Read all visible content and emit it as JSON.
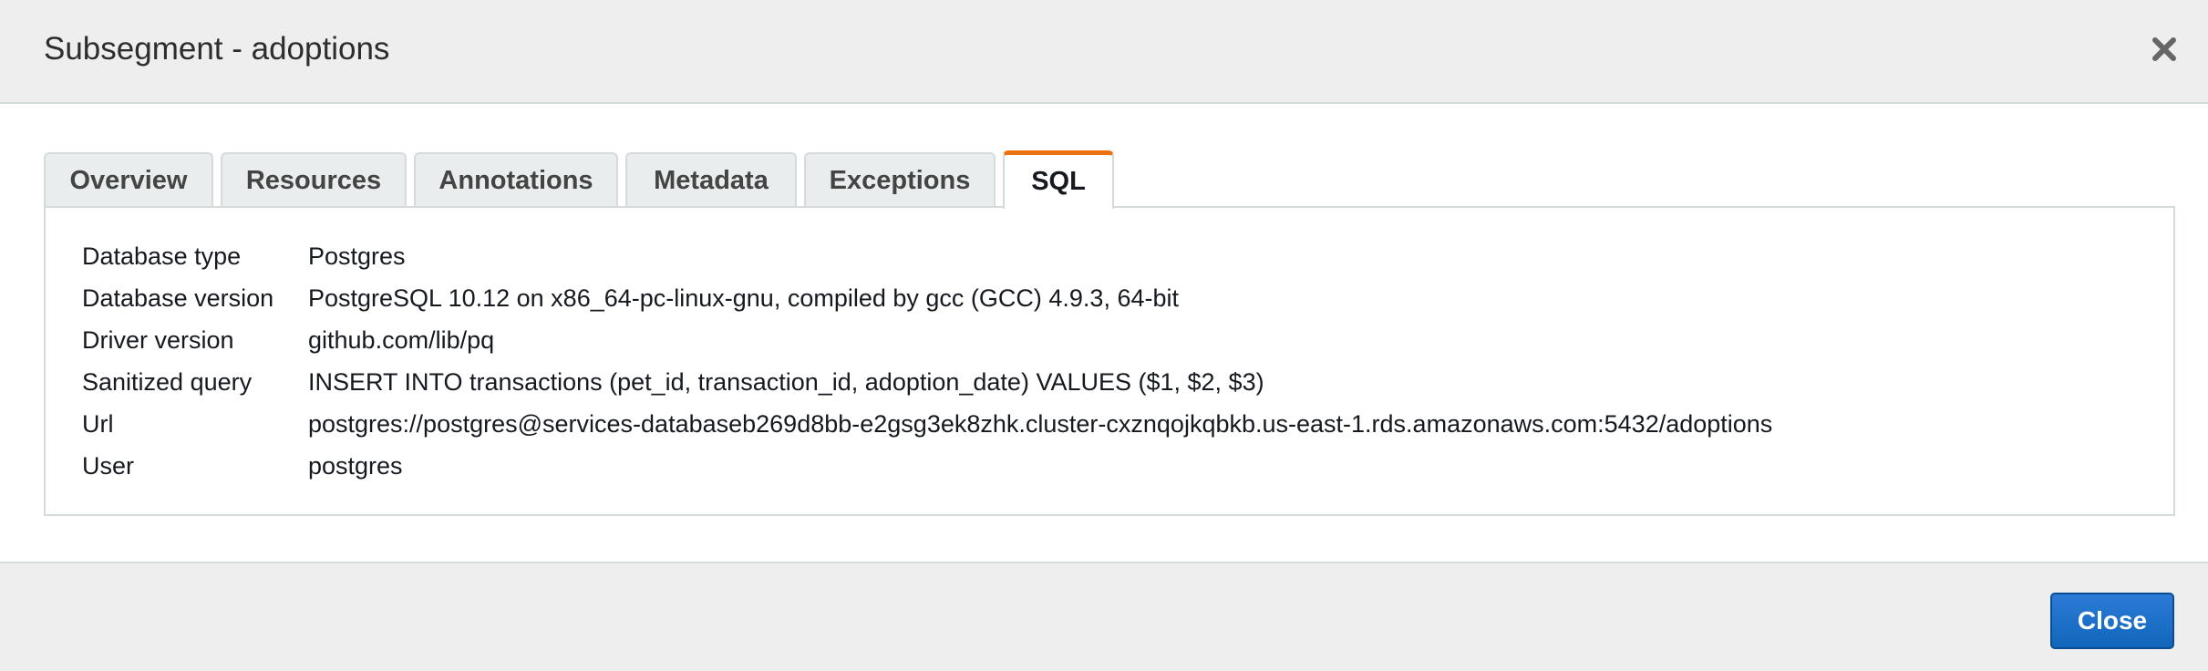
{
  "dialog": {
    "title": "Subsegment - adoptions",
    "close_icon": "close-icon"
  },
  "tabs": [
    {
      "label": "Overview",
      "active": false
    },
    {
      "label": "Resources",
      "active": false
    },
    {
      "label": "Annotations",
      "active": false
    },
    {
      "label": "Metadata",
      "active": false
    },
    {
      "label": "Exceptions",
      "active": false
    },
    {
      "label": "SQL",
      "active": true
    }
  ],
  "sql": {
    "rows": [
      {
        "key": "Database type",
        "value": "Postgres"
      },
      {
        "key": "Database version",
        "value": "PostgreSQL 10.12 on x86_64-pc-linux-gnu, compiled by gcc (GCC) 4.9.3, 64-bit"
      },
      {
        "key": "Driver version",
        "value": "github.com/lib/pq"
      },
      {
        "key": "Sanitized query",
        "value": "INSERT INTO transactions (pet_id, transaction_id, adoption_date) VALUES ($1, $2, $3)"
      },
      {
        "key": "Url",
        "value": "postgres://postgres@services-databaseb269d8bb-e2gsg3ek8zhk.cluster-cxznqojkqbkb.us-east-1.rds.amazonaws.com:5432/adoptions"
      },
      {
        "key": "User",
        "value": "postgres"
      }
    ]
  },
  "footer": {
    "close_label": "Close"
  },
  "colors": {
    "active_tab_accent": "#ec7211",
    "primary_button": "#1166bb"
  }
}
